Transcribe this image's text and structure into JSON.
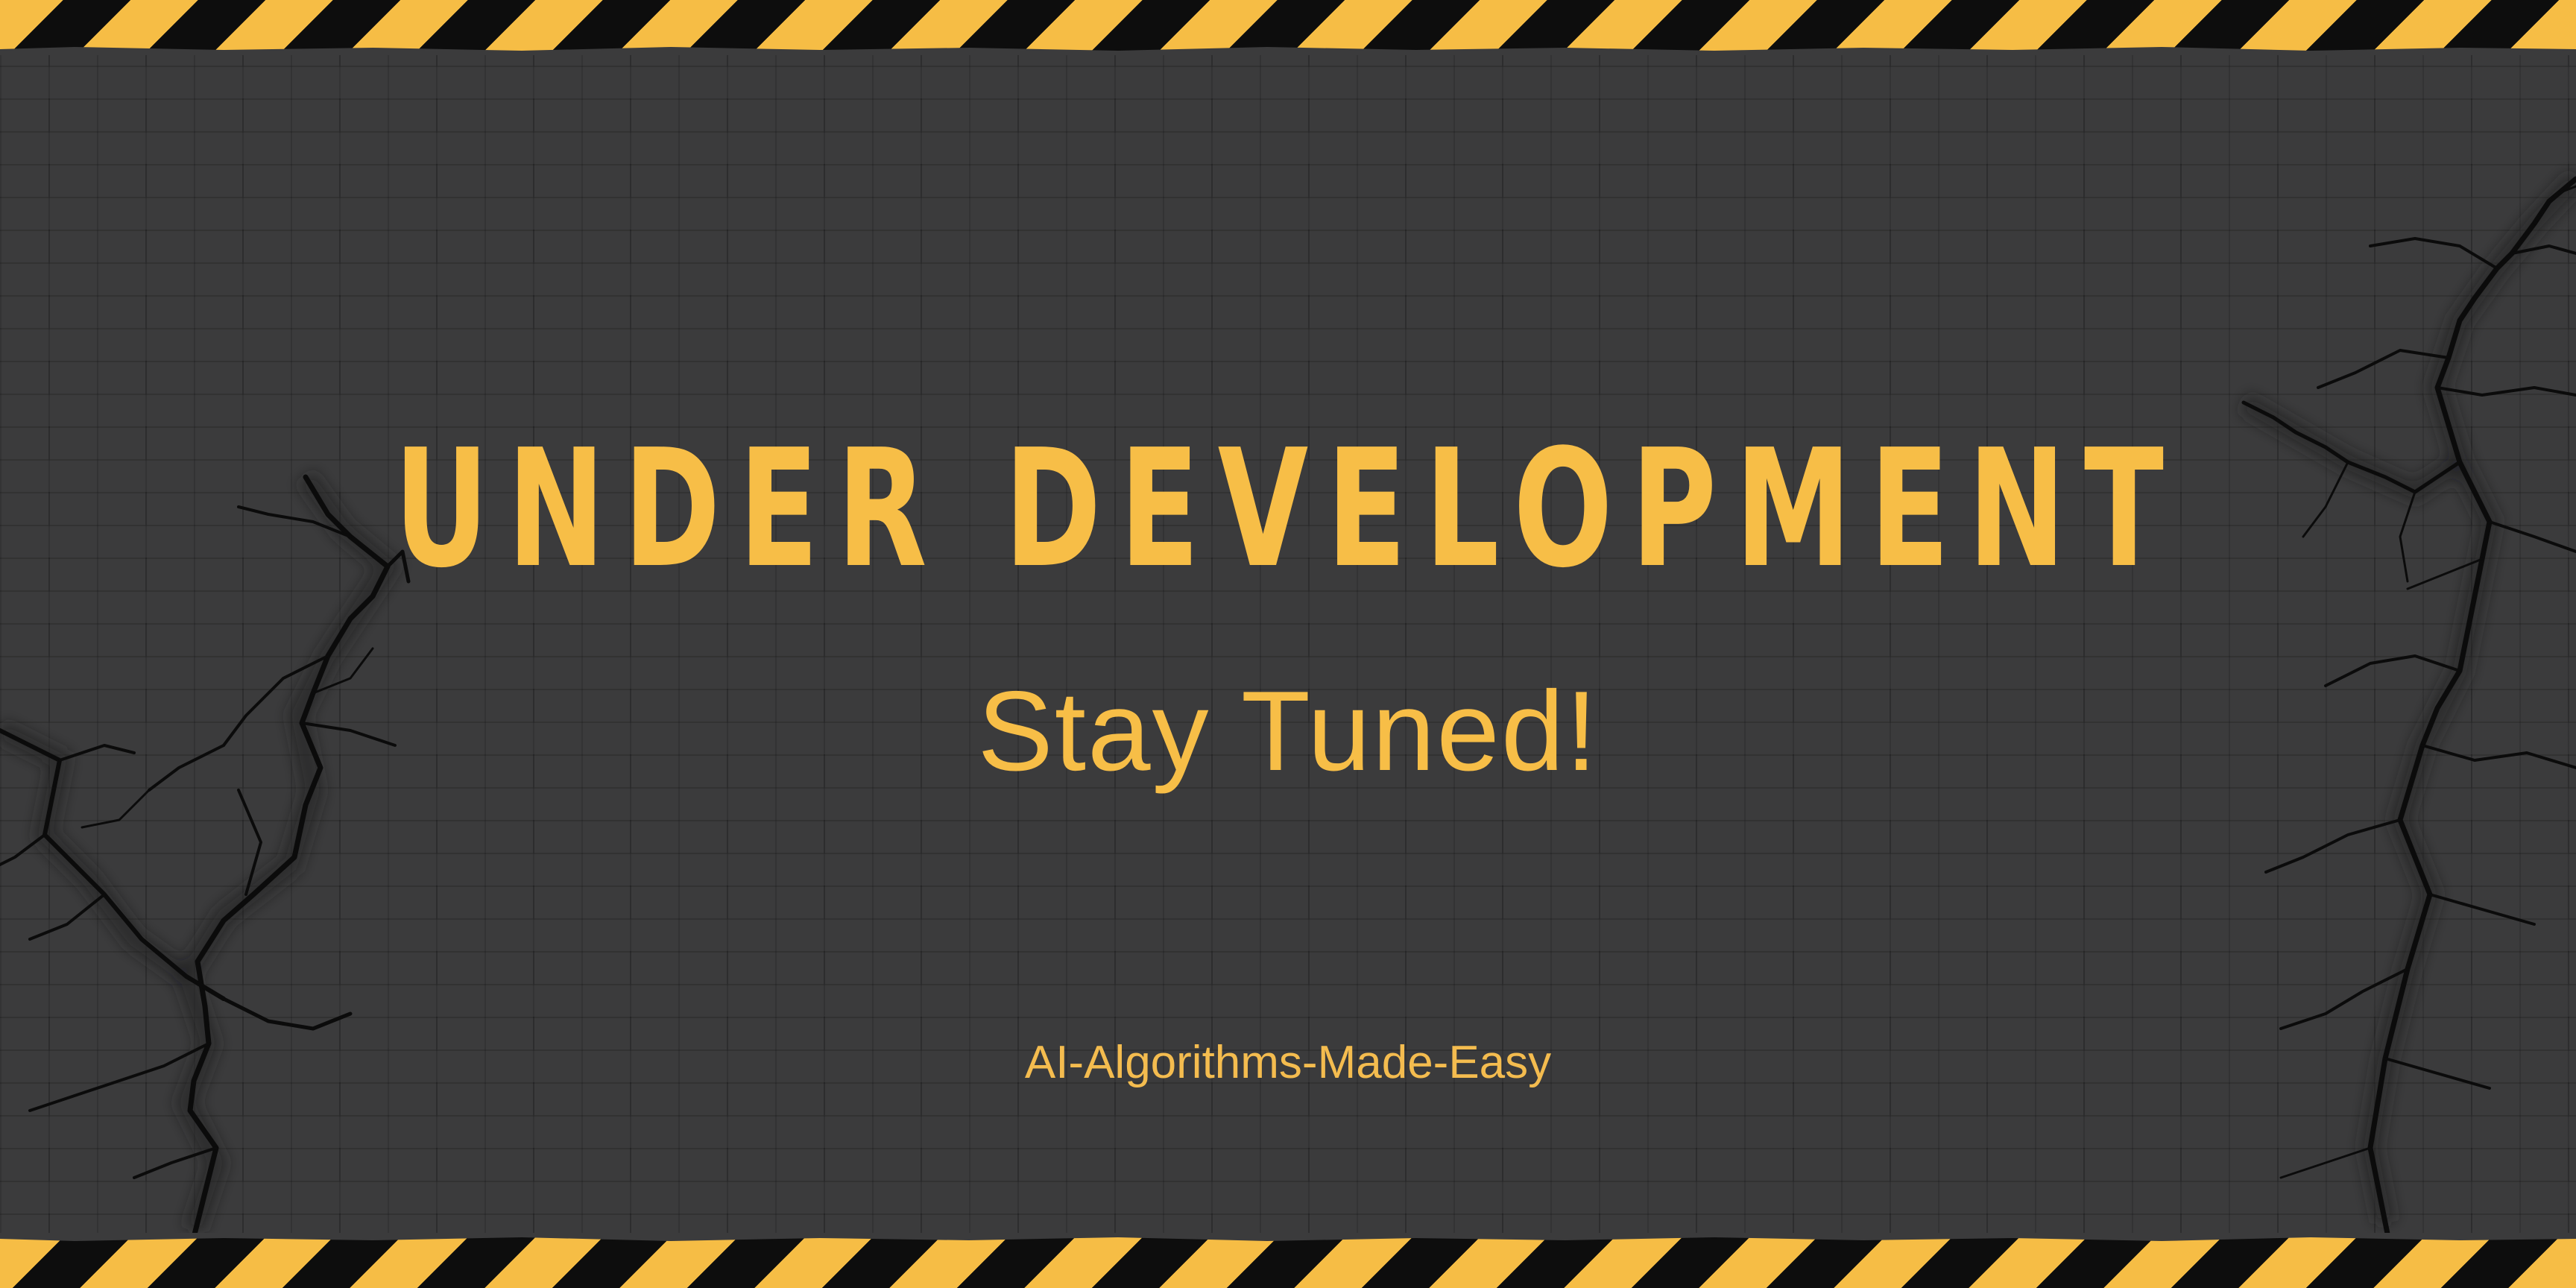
{
  "banner": {
    "headline": "UNDER DEVELOPMENT",
    "subtitle": "Stay Tuned!",
    "footer": "AI-Algorithms-Made-Easy"
  },
  "decor": {
    "tape_icon": "caution-tape-stripes",
    "crack_icon": "wall-crack",
    "wall_icon": "brick-wall"
  },
  "colors": {
    "accent_yellow": "#f7be47",
    "wall_gray": "#3b3b3c",
    "stripe_black": "#0d0d0d"
  }
}
